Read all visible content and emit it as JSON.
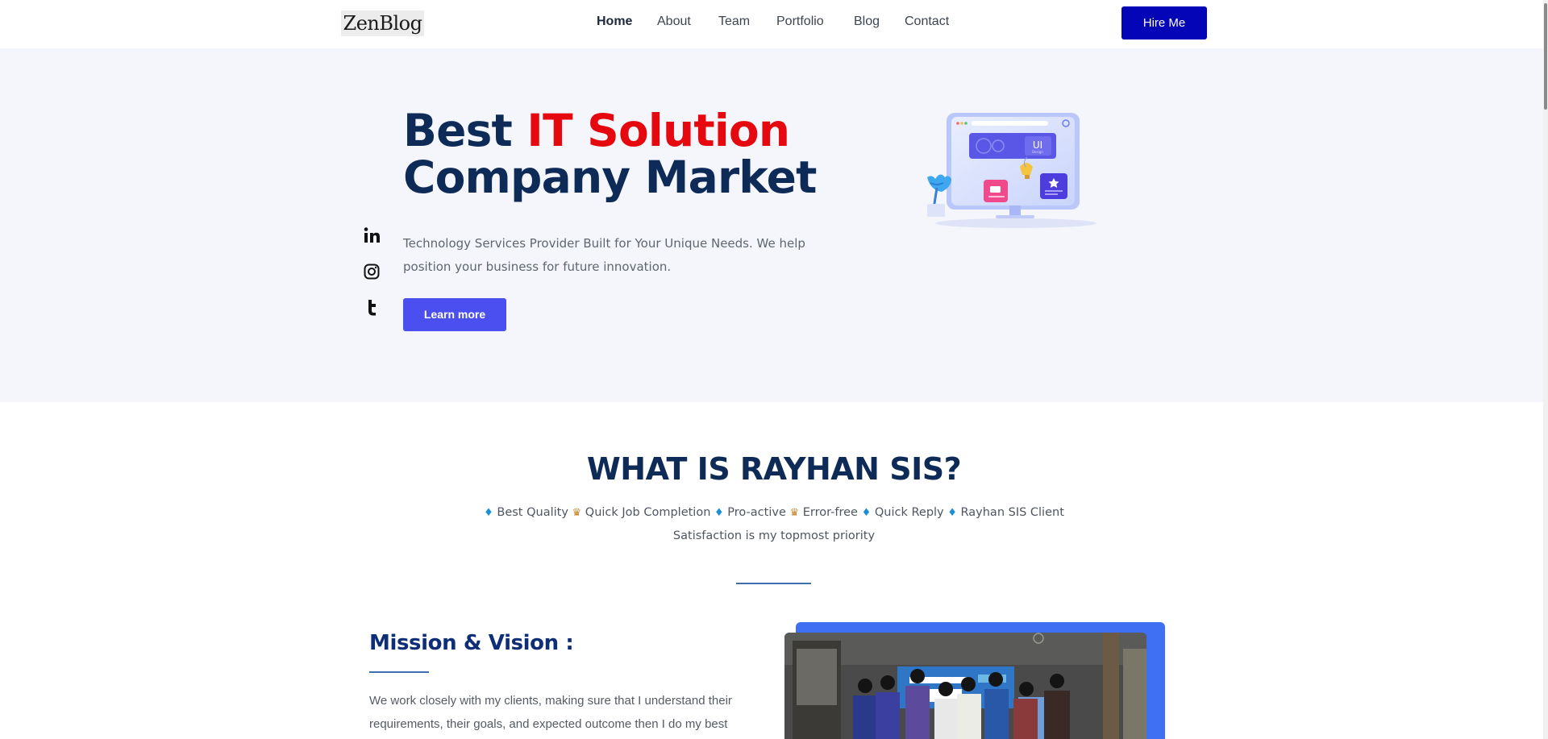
{
  "brand": {
    "logo": "ZenBlog"
  },
  "nav": {
    "items": [
      {
        "label": "Home",
        "active": true
      },
      {
        "label": "About"
      },
      {
        "label": "Team"
      },
      {
        "label": "Portfolio"
      },
      {
        "label": "Blog"
      },
      {
        "label": "Contact"
      }
    ],
    "hire_label": "Hire Me"
  },
  "hero": {
    "title_part1": "Best ",
    "title_accent": "IT Solution",
    "title_line2": "Company Market",
    "description": "Technology Services Provider Built for Your Unique Needs. We help position your business for future innovation.",
    "cta_label": "Learn more",
    "social": [
      "linkedin-icon",
      "instagram-icon",
      "tumblr-icon"
    ],
    "illustration_label": "UI",
    "illustration_sublabel": "Design"
  },
  "about": {
    "title": "WHAT IS RAYHAN SIS?",
    "features": [
      {
        "icon": "gem-icon",
        "text": "Best Quality"
      },
      {
        "icon": "trophy-icon",
        "text": "Quick Job Completion"
      },
      {
        "icon": "gem-icon",
        "text": "Pro-active"
      },
      {
        "icon": "trophy-icon",
        "text": "Error-free"
      },
      {
        "icon": "gem-icon",
        "text": "Quick Reply"
      },
      {
        "icon": "gem-icon",
        "text": "Rayhan SIS Client"
      }
    ],
    "tagline": "Satisfaction is my topmost priority",
    "mission_title": "Mission & Vision :",
    "mission_text": "We work closely with my clients, making sure that I understand their requirements, their goals, and expected outcome then I do my best"
  },
  "colors": {
    "accent_red": "#e6080f",
    "navy": "#0e2b58",
    "hire_button": "#0505b8",
    "cta_button": "#4c4ff0",
    "photo_frame": "#3f6ff2"
  }
}
